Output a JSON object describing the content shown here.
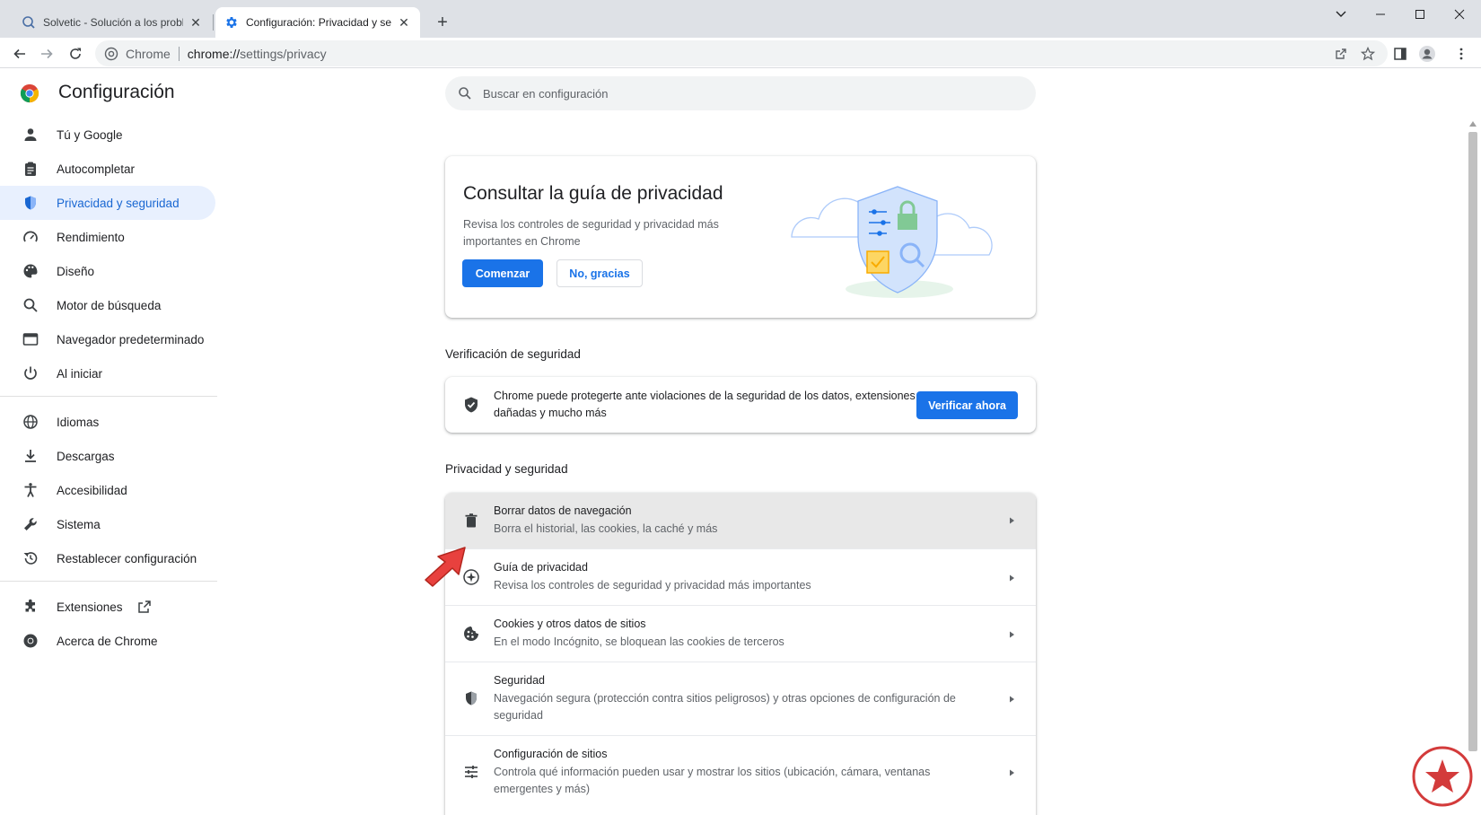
{
  "browser": {
    "tabs": [
      {
        "title": "Solvetic - Solución a los problem",
        "icon": "solvetic-favicon",
        "active": false
      },
      {
        "title": "Configuración: Privacidad y segu",
        "icon": "gear-icon",
        "active": true
      }
    ],
    "new_tab_label": "+",
    "window_controls": {
      "minimize": "—",
      "maximize": "☐",
      "close": "✕"
    },
    "omnibox": {
      "chip": "Chrome",
      "url_host": "chrome://",
      "url_path": "settings/privacy"
    }
  },
  "settings": {
    "title": "Configuración",
    "search_placeholder": "Buscar en configuración",
    "nav": [
      {
        "label": "Tú y Google",
        "icon": "person-icon",
        "selected": false
      },
      {
        "label": "Autocompletar",
        "icon": "clipboard-icon",
        "selected": false
      },
      {
        "label": "Privacidad y seguridad",
        "icon": "shield-icon",
        "selected": true
      },
      {
        "label": "Rendimiento",
        "icon": "speedometer-icon",
        "selected": false
      },
      {
        "label": "Diseño",
        "icon": "palette-icon",
        "selected": false
      },
      {
        "label": "Motor de búsqueda",
        "icon": "search-icon",
        "selected": false
      },
      {
        "label": "Navegador predeterminado",
        "icon": "browser-window-icon",
        "selected": false
      },
      {
        "label": "Al iniciar",
        "icon": "power-icon",
        "selected": false
      },
      {
        "label": "Idiomas",
        "icon": "globe-icon",
        "selected": false
      },
      {
        "label": "Descargas",
        "icon": "download-icon",
        "selected": false
      },
      {
        "label": "Accesibilidad",
        "icon": "accessibility-icon",
        "selected": false
      },
      {
        "label": "Sistema",
        "icon": "wrench-icon",
        "selected": false
      },
      {
        "label": "Restablecer configuración",
        "icon": "restore-icon",
        "selected": false
      },
      {
        "label": "Extensiones",
        "icon": "puzzle-icon",
        "selected": false
      },
      {
        "label": "Acerca de Chrome",
        "icon": "chrome-icon",
        "selected": false
      }
    ],
    "guide": {
      "title": "Consultar la guía de privacidad",
      "description": "Revisa los controles de seguridad y privacidad más importantes en Chrome",
      "start_button": "Comenzar",
      "dismiss_button": "No, gracias"
    },
    "safety_check": {
      "section_title": "Verificación de seguridad",
      "text": "Chrome puede protegerte ante violaciones de la seguridad de los datos, extensiones dañadas y mucho más",
      "button": "Verificar ahora"
    },
    "privacy": {
      "section_title": "Privacidad y seguridad",
      "rows": [
        {
          "label": "Borrar datos de navegación",
          "sub": "Borra el historial, las cookies, la caché y más",
          "icon": "trash-icon"
        },
        {
          "label": "Guía de privacidad",
          "sub": "Revisa los controles de seguridad y privacidad más importantes",
          "icon": "compass-icon"
        },
        {
          "label": "Cookies y otros datos de sitios",
          "sub": "En el modo Incógnito, se bloquean las cookies de terceros",
          "icon": "cookie-icon"
        },
        {
          "label": "Seguridad",
          "sub": "Navegación segura (protección contra sitios peligrosos) y otras opciones de configuración de seguridad",
          "icon": "shield-icon"
        },
        {
          "label": "Configuración de sitios",
          "sub": "Controla qué información pueden usar y mostrar los sitios (ubicación, cámara, ventanas emergentes y más)",
          "icon": "sliders-icon"
        }
      ]
    }
  },
  "colors": {
    "accent": "#1a73e8",
    "nav_selected_bg": "#e8f0fe",
    "nav_selected_text": "#1967d2",
    "annotation_arrow": "#e8413e"
  }
}
